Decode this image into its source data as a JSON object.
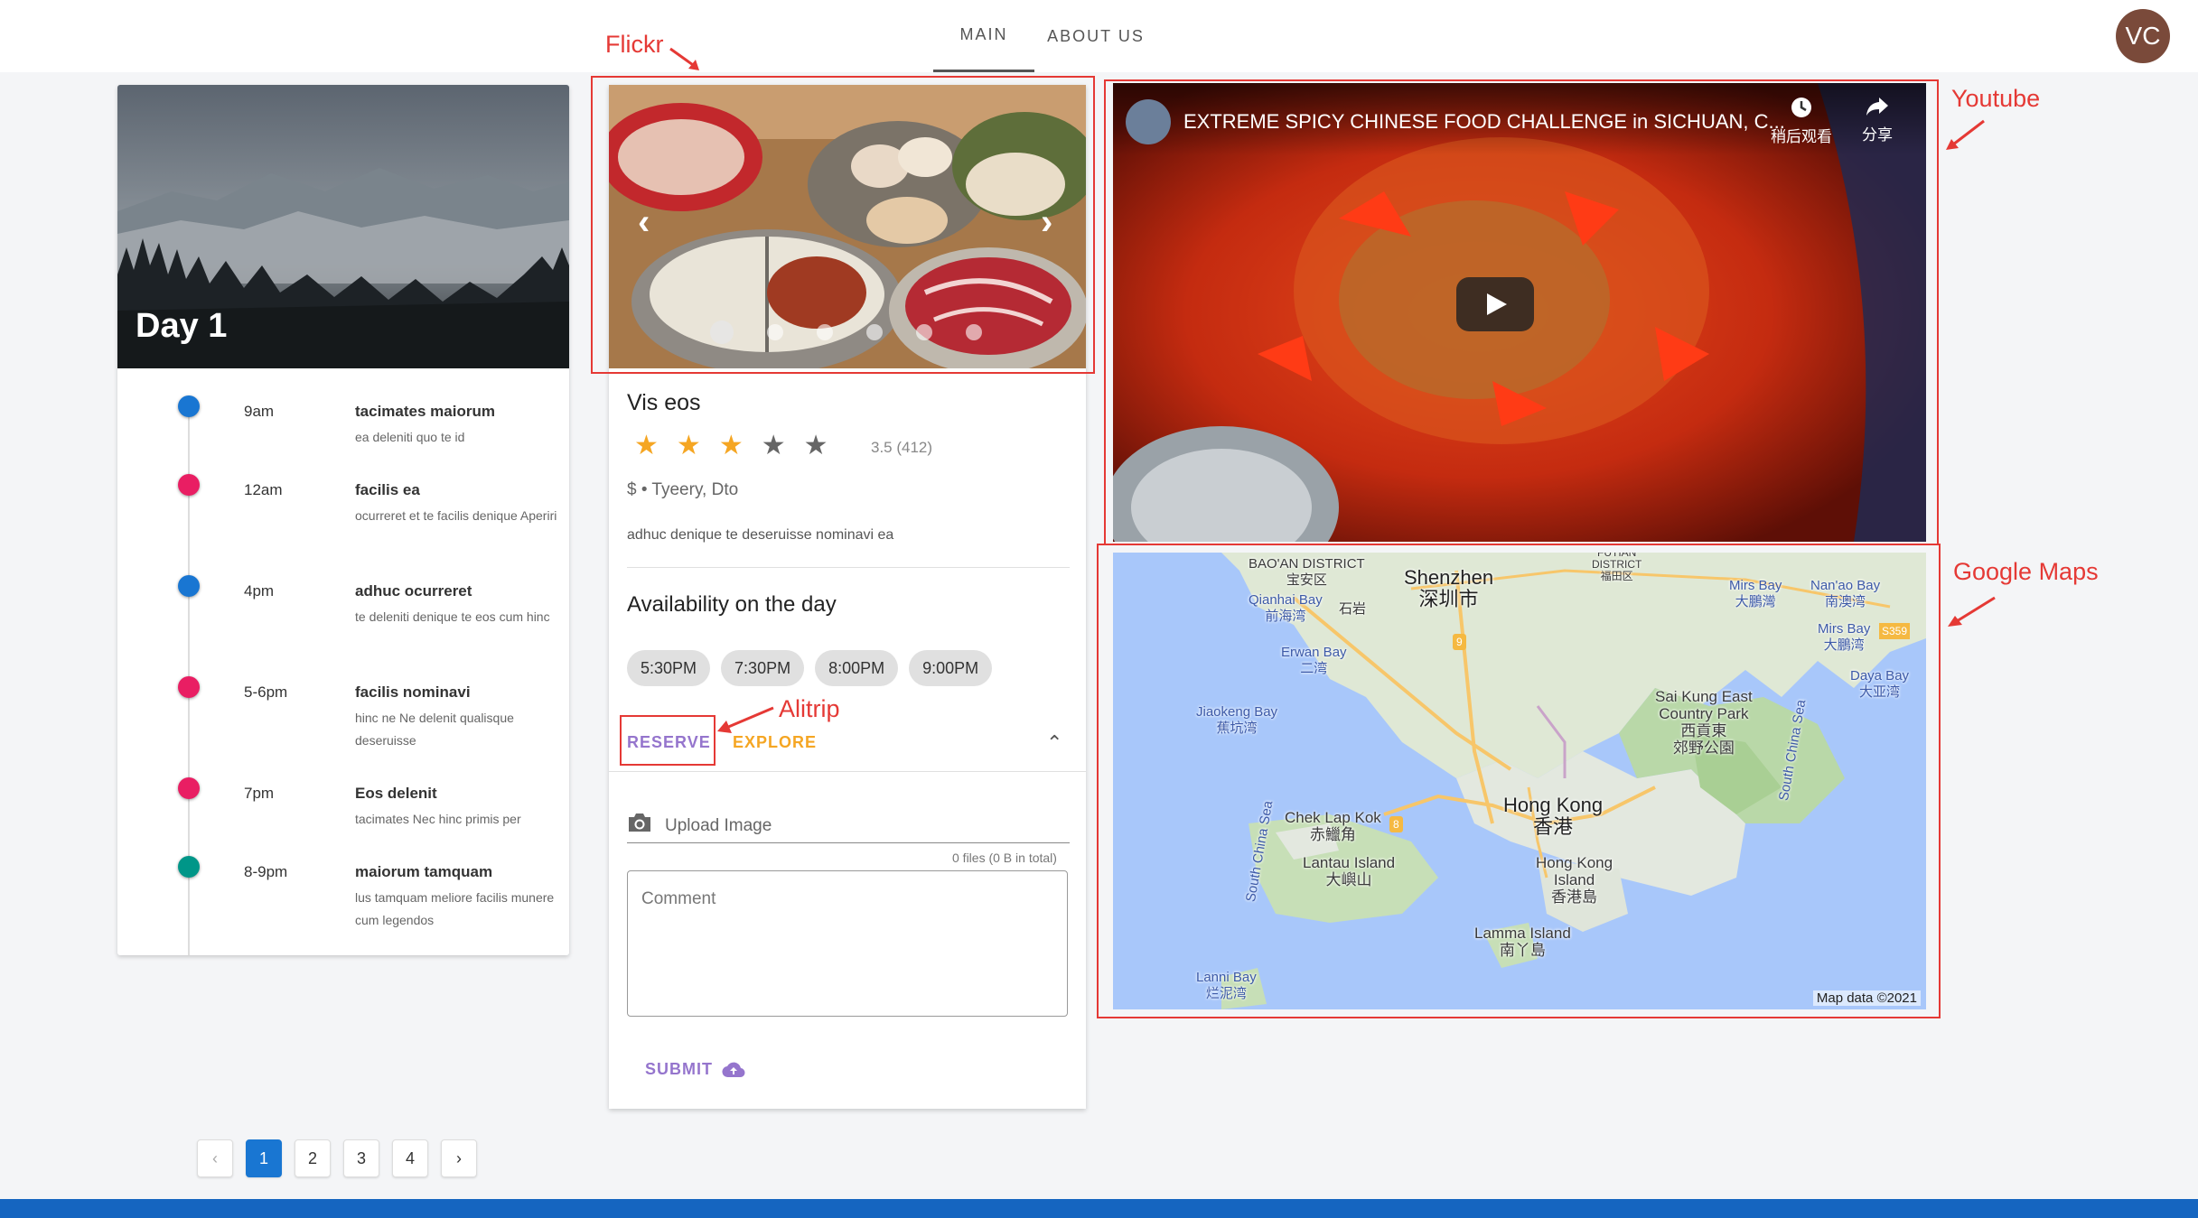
{
  "nav": {
    "tabs": [
      {
        "label": "MAIN",
        "active": true
      },
      {
        "label": "ABOUT US",
        "active": false
      }
    ],
    "avatar_initials": "VC"
  },
  "annotations": {
    "flickr": "Flickr",
    "youtube": "Youtube",
    "google_maps": "Google Maps",
    "alitrip": "Alitrip",
    "color": "#e53935"
  },
  "day_card": {
    "title": "Day 1",
    "timeline": [
      {
        "time": "9am",
        "title": "tacimates maiorum",
        "desc": "ea deleniti quo te id",
        "color": "#1976d2"
      },
      {
        "time": "12am",
        "title": "facilis ea",
        "desc": "ocurreret et te facilis denique Aperiri",
        "color": "#e91e63"
      },
      {
        "time": "4pm",
        "title": "adhuc ocurreret",
        "desc": "te deleniti denique te eos cum hinc",
        "color": "#1976d2"
      },
      {
        "time": "5-6pm",
        "title": "facilis nominavi",
        "desc": "hinc ne Ne delenit qualisque deseruisse",
        "color": "#e91e63"
      },
      {
        "time": "7pm",
        "title": "Eos delenit",
        "desc": "tacimates Nec hinc primis per",
        "color": "#e91e63"
      },
      {
        "time": "8-9pm",
        "title": "maiorum tamquam",
        "desc": "lus tamquam meliore facilis munere cum legendos",
        "color": "#009688"
      }
    ]
  },
  "venue": {
    "carousel": {
      "slide_count": 6,
      "active_index": 0
    },
    "title": "Vis eos",
    "rating_value": 3.5,
    "rating_text": "3.5 (412)",
    "price_location": "$ • Tyeery, Dto",
    "description": "adhuc denique te deseruisse nominavi ea",
    "availability_title": "Availability on the day",
    "times": [
      "5:30PM",
      "7:30PM",
      "8:00PM",
      "9:00PM"
    ],
    "reserve_label": "RESERVE",
    "explore_label": "EXPLORE",
    "upload_label": "Upload Image",
    "files_count": "0 files (0 B in total)",
    "comment_label": "Comment",
    "submit_label": "SUBMIT",
    "colors": {
      "reserve": "#9575cd",
      "explore": "#f5a623",
      "star": "#f5a623"
    }
  },
  "youtube": {
    "title": "EXTREME SPICY CHINESE FOOD CHALLENGE in SICHUAN, C...",
    "watch_later": "稍后观看",
    "share": "分享"
  },
  "map": {
    "labels": {
      "baoan": "BAO'AN DISTRICT\n宝安区",
      "shenzhen": "Shenzhen\n深圳市",
      "futian": "FUTIAN\nDISTRICT\n福田区",
      "mirs_bay": "Mirs Bay\n大鵬灣",
      "nanao_bay": "Nan'ao Bay\n南澳湾",
      "qianhai": "Qianhai Bay\n前海湾",
      "shiyan": "石岩",
      "mirs_bay_2": "Mirs Bay\n大鵬湾",
      "s359": "S359",
      "erwan": "Erwan Bay\n二湾",
      "daya": "Daya Bay\n大亚湾",
      "sai_kung": "Sai Kung East\nCountry Park\n西貢東\n郊野公園",
      "jiaokeng": "Jiaokeng Bay\n蕉坑湾",
      "scs_east": "South China Sea",
      "scs_west": "South China Sea",
      "chek_lap_kok": "Chek Lap Kok\n赤鱲角",
      "hong_kong": "Hong Kong\n香港",
      "lantau": "Lantau Island\n大嶼山",
      "hk_island": "Hong Kong\nIsland\n香港島",
      "lamma": "Lamma Island\n南丫島",
      "lanni": "Lanni Bay\n烂泥湾",
      "road_9": "9",
      "road_8": "8"
    },
    "attribution": "Map data ©2021"
  },
  "pagination": {
    "pages": [
      "1",
      "2",
      "3",
      "4"
    ],
    "active": "1",
    "prev": "‹",
    "next": "›"
  }
}
